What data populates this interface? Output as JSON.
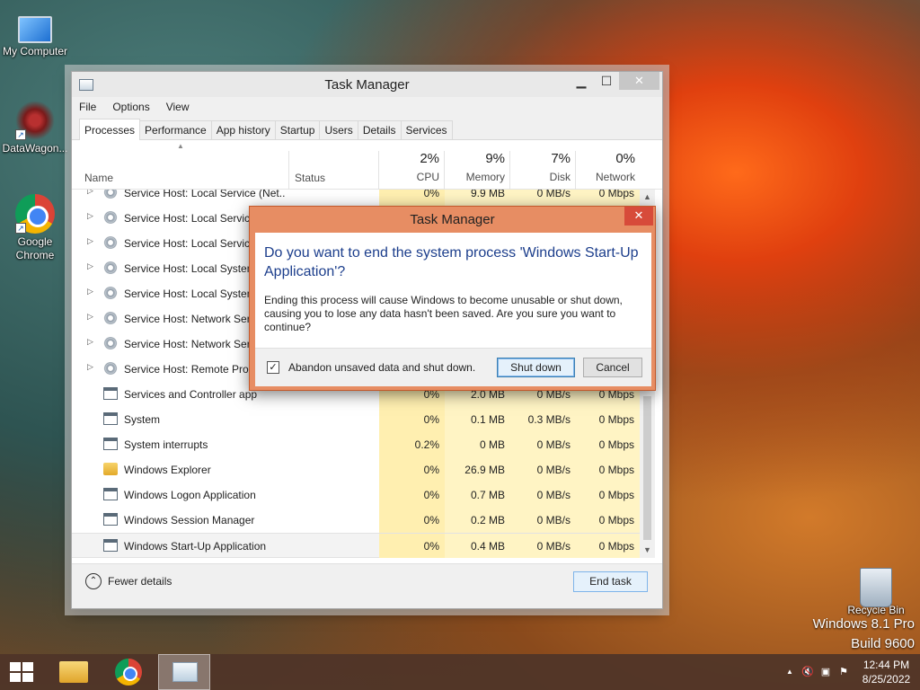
{
  "desktop": {
    "icons": [
      {
        "label": "My Computer"
      },
      {
        "label": "DataWagon..."
      },
      {
        "label": "Google Chrome"
      },
      {
        "label": "Recycle Bin"
      }
    ],
    "watermark": {
      "line1": "Windows 8.1 Pro",
      "line2": "Build 9600"
    }
  },
  "window": {
    "title": "Task Manager",
    "controls": {
      "minimize": "▁",
      "maximize": "☐",
      "close": "✕"
    },
    "menu": [
      "File",
      "Options",
      "View"
    ],
    "tabs": [
      "Processes",
      "Performance",
      "App history",
      "Startup",
      "Users",
      "Details",
      "Services"
    ],
    "active_tab": "Processes",
    "columns": {
      "name": "Name",
      "status": "Status",
      "cpu": {
        "pct": "2%",
        "label": "CPU"
      },
      "memory": {
        "pct": "9%",
        "label": "Memory"
      },
      "disk": {
        "pct": "7%",
        "label": "Disk"
      },
      "network": {
        "pct": "0%",
        "label": "Network"
      }
    },
    "rows": [
      {
        "name": "Service Host: Local Service (Net...",
        "cpu": "0%",
        "mem": "9.9 MB",
        "disk": "0 MB/s",
        "net": "0 Mbps",
        "icon": "gear",
        "expand": true
      },
      {
        "name": "Service Host: Local Service",
        "cpu": "",
        "mem": "",
        "disk": "",
        "net": "",
        "icon": "gear",
        "expand": true
      },
      {
        "name": "Service Host: Local Service",
        "cpu": "",
        "mem": "",
        "disk": "",
        "net": "",
        "icon": "gear",
        "expand": true
      },
      {
        "name": "Service Host: Local System",
        "cpu": "",
        "mem": "",
        "disk": "",
        "net": "",
        "icon": "gear",
        "expand": true
      },
      {
        "name": "Service Host: Local System",
        "cpu": "",
        "mem": "",
        "disk": "",
        "net": "",
        "icon": "gear",
        "expand": true
      },
      {
        "name": "Service Host: Network Serv",
        "cpu": "",
        "mem": "",
        "disk": "",
        "net": "",
        "icon": "gear",
        "expand": true
      },
      {
        "name": "Service Host: Network Serv",
        "cpu": "",
        "mem": "",
        "disk": "",
        "net": "",
        "icon": "gear",
        "expand": true
      },
      {
        "name": "Service Host: Remote Proc",
        "cpu": "",
        "mem": "",
        "disk": "",
        "net": "",
        "icon": "gear",
        "expand": true
      },
      {
        "name": "Services and Controller app",
        "cpu": "0%",
        "mem": "2.0 MB",
        "disk": "0 MB/s",
        "net": "0 Mbps",
        "icon": "app",
        "expand": false
      },
      {
        "name": "System",
        "cpu": "0%",
        "mem": "0.1 MB",
        "disk": "0.3 MB/s",
        "net": "0 Mbps",
        "icon": "app",
        "expand": false
      },
      {
        "name": "System interrupts",
        "cpu": "0.2%",
        "mem": "0 MB",
        "disk": "0 MB/s",
        "net": "0 Mbps",
        "icon": "app",
        "expand": false
      },
      {
        "name": "Windows Explorer",
        "cpu": "0%",
        "mem": "26.9 MB",
        "disk": "0 MB/s",
        "net": "0 Mbps",
        "icon": "folder",
        "expand": false
      },
      {
        "name": "Windows Logon Application",
        "cpu": "0%",
        "mem": "0.7 MB",
        "disk": "0 MB/s",
        "net": "0 Mbps",
        "icon": "app",
        "expand": false
      },
      {
        "name": "Windows Session Manager",
        "cpu": "0%",
        "mem": "0.2 MB",
        "disk": "0 MB/s",
        "net": "0 Mbps",
        "icon": "app",
        "expand": false
      },
      {
        "name": "Windows Start-Up Application",
        "cpu": "0%",
        "mem": "0.4 MB",
        "disk": "0 MB/s",
        "net": "0 Mbps",
        "icon": "app",
        "expand": false
      }
    ],
    "selected_row_index": 14,
    "footer": {
      "fewer_details": "Fewer details",
      "end_task": "End task"
    }
  },
  "dialog": {
    "title": "Task Manager",
    "close": "✕",
    "main_instruction": "Do you want to end the system process 'Windows Start-Up Application'?",
    "content": "Ending this process will cause Windows to become unusable or shut down, causing you to lose any data hasn't been saved. Are you sure you want to continue?",
    "checkbox_label": "Abandon unsaved data and shut down.",
    "checkbox_checked": true,
    "checkmark": "✓",
    "primary_button": "Shut down",
    "cancel_button": "Cancel"
  },
  "taskbar": {
    "clock_time": "12:44 PM",
    "clock_date": "8/25/2022",
    "tray_icons": [
      "show-hidden-icons",
      "speaker-muted-icon",
      "network-icon",
      "action-center-icon"
    ],
    "tray_glyphs": {
      "chevron": "▲",
      "speaker": "🔇",
      "network": "▣",
      "flag": "⚑"
    }
  },
  "colors": {
    "dialog_frame": "#e78d63",
    "main_instruction": "#1c3e8c",
    "heat": "#fff4c4"
  }
}
